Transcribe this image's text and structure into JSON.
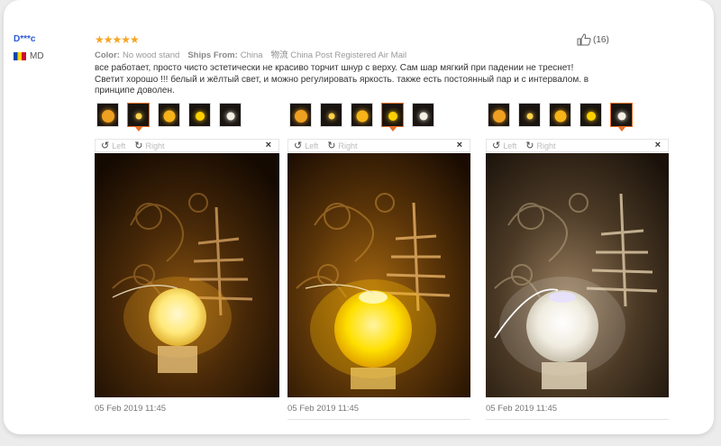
{
  "review": {
    "user": "D***c",
    "country": "MD",
    "stars": "★★★★★",
    "color_label": "Color:",
    "color_value": "No wood stand",
    "ships_label": "Ships From:",
    "ships_value": "China",
    "logistics_label": "物流",
    "logistics_value": "China Post Registered Air Mail",
    "helpful_count": "(16)",
    "comment": "все работает, просто чисто эстетически не красиво торчит шнур с верху. Сам шар мягкий при падении не треснет! Светит хорошо !!! белый и жёлтый свет, и можно регулировать яркость. также есть постоянный пар и с интервалом. в принципе доволен."
  },
  "viewer": {
    "left_label": "Left",
    "right_label": "Right",
    "close_label": "×"
  },
  "photos": [
    {
      "date": "05 Feb 2019 11:45",
      "selected_thumb": 1
    },
    {
      "date": "05 Feb 2019 11:45",
      "selected_thumb": 3
    },
    {
      "date": "05 Feb 2019 11:45",
      "selected_thumb": 4
    }
  ],
  "thumbnails": [
    {
      "name": "thumb-amber",
      "glow": "#f0a020"
    },
    {
      "name": "thumb-yellow-small",
      "glow": "#ffd24a"
    },
    {
      "name": "thumb-orange",
      "glow": "#f7b318"
    },
    {
      "name": "thumb-yellow",
      "glow": "#ffd000"
    },
    {
      "name": "thumb-white",
      "glow": "#f4efe4"
    }
  ],
  "colors": {
    "star": "#f5a623",
    "accent": "#e8702a",
    "link": "#2a5bd7"
  }
}
